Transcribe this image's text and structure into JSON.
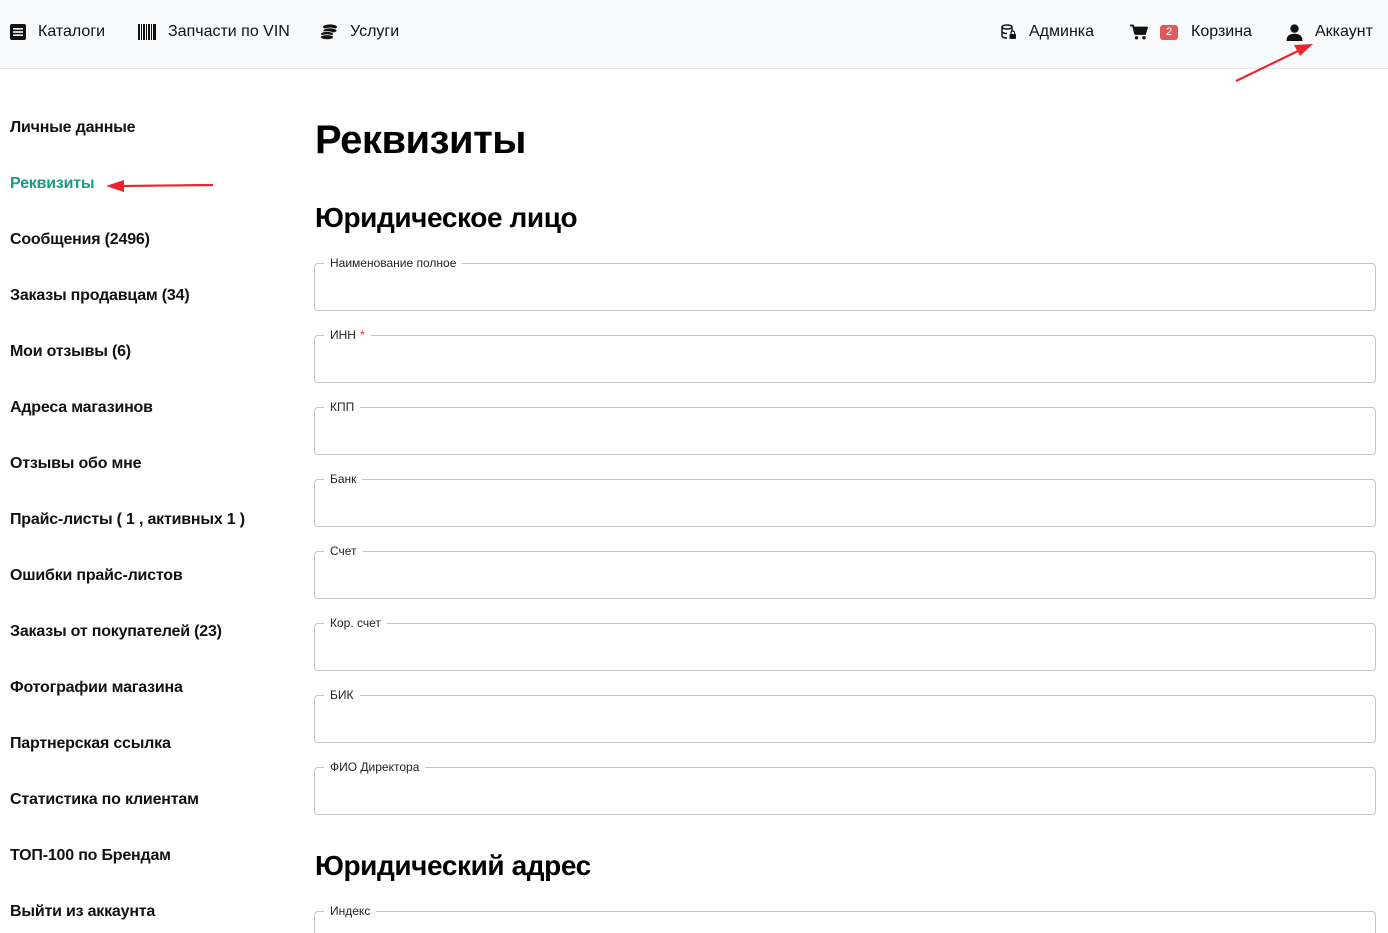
{
  "header": {
    "catalogs": "Каталоги",
    "vin": "Запчасти по VIN",
    "services": "Услуги",
    "admin": "Админка",
    "cart_count": "2",
    "cart": "Корзина",
    "account": "Аккаунт"
  },
  "sidebar": {
    "items": [
      {
        "label": "Личные данные"
      },
      {
        "label": "Реквизиты"
      },
      {
        "label": "Сообщения (2496)"
      },
      {
        "label": "Заказы продавцам (34)"
      },
      {
        "label": "Мои отзывы (6)"
      },
      {
        "label": "Адреса магазинов"
      },
      {
        "label": "Отзывы обо мне"
      },
      {
        "label": "Прайс-листы ( 1 , активных 1 )"
      },
      {
        "label": "Ошибки прайс-листов"
      },
      {
        "label": "Заказы от покупателей (23)"
      },
      {
        "label": "Фотографии магазина"
      },
      {
        "label": "Партнерская ссылка"
      },
      {
        "label": "Статистика по клиентам"
      },
      {
        "label": "ТОП-100 по Брендам"
      },
      {
        "label": "Выйти из аккаунта"
      }
    ],
    "active_index": 1
  },
  "main": {
    "title": "Реквизиты",
    "legal_entity": {
      "title": "Юридическое лицо",
      "fields": [
        {
          "label": "Наименование полное",
          "value": "",
          "required": false
        },
        {
          "label": "ИНН",
          "value": "",
          "required": true,
          "required_mark": "*"
        },
        {
          "label": "КПП",
          "value": "",
          "required": false
        },
        {
          "label": "Банк",
          "value": "",
          "required": false
        },
        {
          "label": "Счет",
          "value": "",
          "required": false
        },
        {
          "label": "Кор. счет",
          "value": "",
          "required": false
        },
        {
          "label": "БИК",
          "value": "",
          "required": false
        },
        {
          "label": "ФИО Директора",
          "value": "",
          "required": false
        }
      ]
    },
    "legal_address": {
      "title": "Юридический адрес",
      "fields": [
        {
          "label": "Индекс",
          "value": ""
        }
      ]
    }
  },
  "colors": {
    "accent": "#1a9b82",
    "badge": "#e05a5a",
    "annotation_arrow": "#e8262b"
  }
}
